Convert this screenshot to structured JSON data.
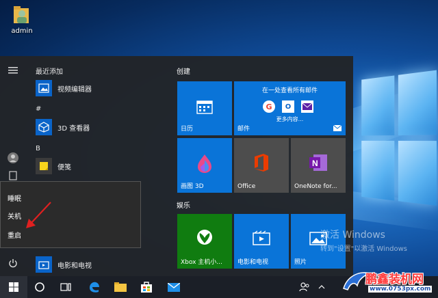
{
  "desktop": {
    "icon_label": "admin"
  },
  "start_menu": {
    "recent_header": "最近添加",
    "letter_hash": "#",
    "letter_b": "B",
    "apps": [
      {
        "name": "视频编辑器",
        "icon": "video-editor-icon"
      },
      {
        "name": "3D 查看器",
        "icon": "3d-viewer-icon"
      },
      {
        "name": "便笺",
        "icon": "sticky-notes-icon"
      },
      {
        "name": "电影和电视",
        "icon": "movies-tv-icon"
      }
    ],
    "group_create": "创建",
    "group_entertainment": "娱乐",
    "tiles": {
      "calendar": "日历",
      "mail": "邮件",
      "mail_header": "在一处查看所有邮件",
      "mail_more": "更多内容...",
      "paint3d": "画图 3D",
      "office": "Office",
      "onenote": "OneNote for...",
      "xbox": "Xbox 主机小...",
      "movies": "电影和电视",
      "photos": "照片"
    }
  },
  "power_menu": {
    "sleep": "睡眠",
    "shutdown": "关机",
    "restart": "重启"
  },
  "activation": {
    "line1": "激活 Windows",
    "line2": "转到\"设置\"以激活 Windows"
  },
  "brand": {
    "name": "鹏鑫装机网",
    "url": "www.0753px.com"
  },
  "colors": {
    "accent": "#0a74d8",
    "start_bg": "#222428",
    "taskbar_bg": "#1b1f27",
    "arrow": "#e02020"
  }
}
